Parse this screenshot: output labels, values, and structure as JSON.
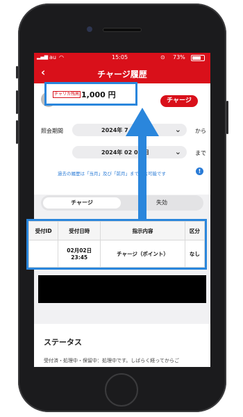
{
  "status_bar": {
    "carrier": "au",
    "time": "15:05",
    "battery": "73%"
  },
  "nav": {
    "back_icon": "chevron-left-icon",
    "title": "チャージ履歴"
  },
  "balance": {
    "label": "チャリカ残高",
    "value": "1,000 円"
  },
  "charge_button": "チャージ",
  "period": {
    "label": "照会期間",
    "from_value": "2024年    7 日",
    "to_value": "2024年 02   05 日",
    "from_suffix": "から",
    "to_suffix": "まで"
  },
  "note": "過去の履歴は「当月」及び「前月」まで照会可能です",
  "tabs": {
    "active": "チャージ",
    "inactive": "失効"
  },
  "table": {
    "headers": [
      "受付ID",
      "受付日時",
      "指示内容",
      "区分"
    ],
    "row": {
      "id": "",
      "date": "02月02日",
      "time": "23:45",
      "instruction": "チャージ（ポイント）",
      "category": "なし"
    }
  },
  "status": {
    "title": "ステータス",
    "description": "受付済・処理中・保留中：処理中です。しばらく経ってからご"
  },
  "colors": {
    "brand_red": "#d9101a",
    "annotation_blue": "#2a86dc",
    "link_blue": "#2a7bd6"
  }
}
